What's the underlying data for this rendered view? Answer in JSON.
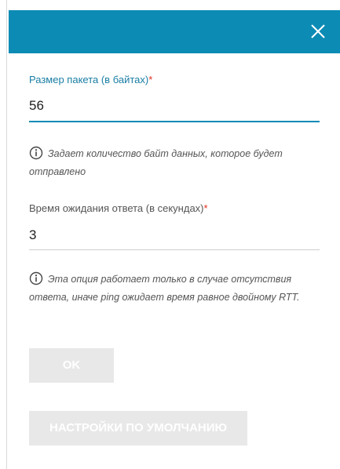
{
  "dialog": {
    "close_icon": "close-icon",
    "header_color": "#0c8bb5"
  },
  "packet_size": {
    "label": "Размер пакета (в байтах)",
    "required_mark": "*",
    "value": "56",
    "hint": "Задает количество байт данных, которое будет отправлено"
  },
  "timeout": {
    "label": "Время ожидания ответа (в секундах)",
    "required_mark": "*",
    "value": "3",
    "hint": "Эта опция работает только в случае отсутствия ответа, иначе ping ожидает время равное двойному RTT."
  },
  "buttons": {
    "ok_label": "OK",
    "defaults_label": "НАСТРОЙКИ ПО УМОЛЧАНИЮ"
  },
  "colors": {
    "accent": "#0c8bb5",
    "required": "#e0301e",
    "disabled_button_bg": "#e8e8e8"
  }
}
